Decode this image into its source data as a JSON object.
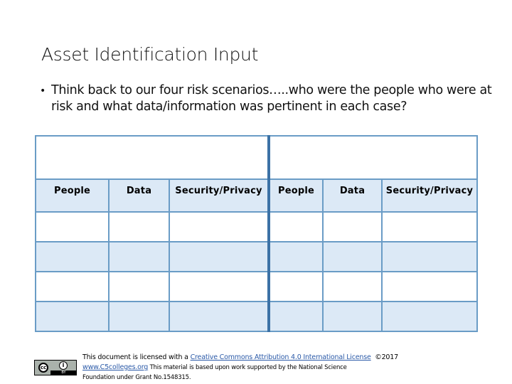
{
  "slide": {
    "title": "Asset Identification Input",
    "bullet": "Think back to our four risk scenarios…..who were the people who were at risk and what data/information was pertinent in each case?"
  },
  "table": {
    "groups": [
      {
        "label": ""
      },
      {
        "label": ""
      }
    ],
    "headers": [
      "People",
      "Data",
      "Security/Privacy",
      "People",
      "Data",
      "Security/Privacy"
    ],
    "rows": [
      [
        "",
        "",
        "",
        "",
        "",
        ""
      ],
      [
        "",
        "",
        "",
        "",
        "",
        ""
      ],
      [
        "",
        "",
        "",
        "",
        "",
        ""
      ],
      [
        "",
        "",
        "",
        "",
        "",
        ""
      ]
    ],
    "colors": {
      "border": "#6a9cc6",
      "separator": "#3c72a6",
      "shaded": "#dce9f6"
    }
  },
  "footer": {
    "badge_icon": "cc-by-license-icon",
    "badge_cc": "cc",
    "badge_by": "BY",
    "line1_prefix": "This document is licensed with a ",
    "license_link": "Creative Commons Attribution 4.0 International License",
    "line1_suffix": "  ©2017",
    "site_link": "www.C5colleges.org",
    "line2_text": " This material is based upon work supported by the National Science",
    "line3_text": "Foundation under Grant No.1548315."
  }
}
